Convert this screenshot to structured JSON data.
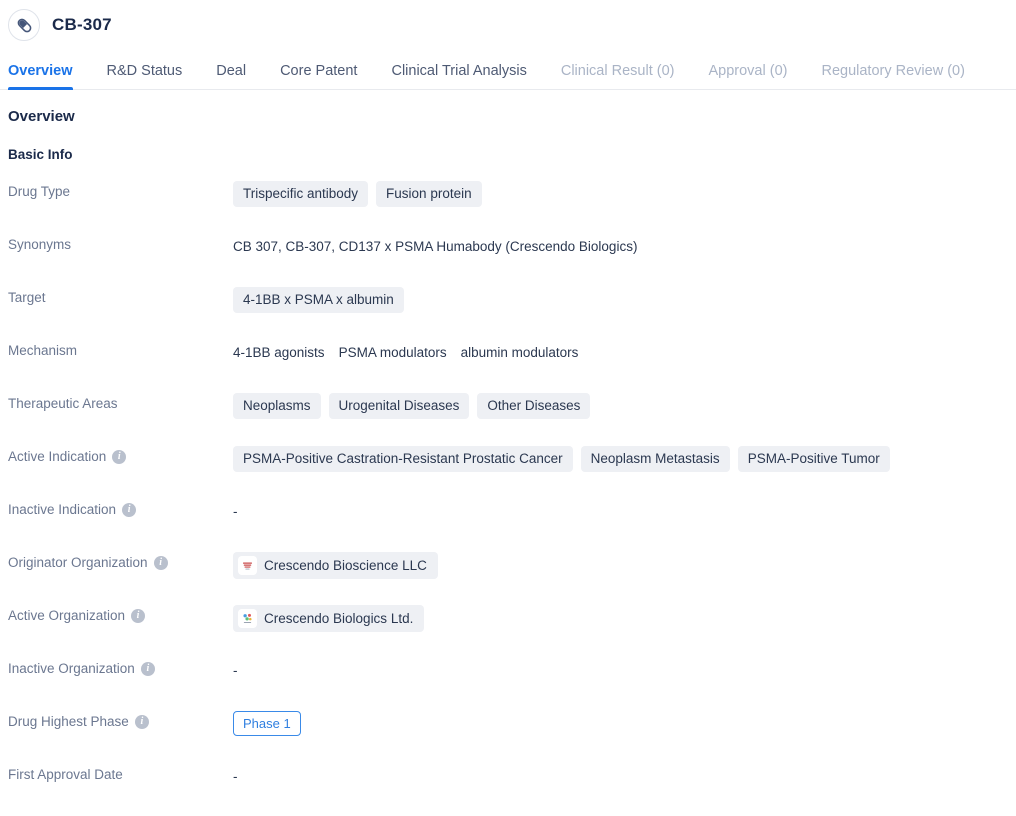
{
  "header": {
    "icon": "pill-icon",
    "title": "CB-307"
  },
  "tabs": [
    {
      "label": "Overview",
      "state": "active"
    },
    {
      "label": "R&D Status",
      "state": "enabled"
    },
    {
      "label": "Deal",
      "state": "enabled"
    },
    {
      "label": "Core Patent",
      "state": "enabled"
    },
    {
      "label": "Clinical Trial Analysis",
      "state": "enabled"
    },
    {
      "label": "Clinical Result (0)",
      "state": "disabled"
    },
    {
      "label": "Approval (0)",
      "state": "disabled"
    },
    {
      "label": "Regulatory Review (0)",
      "state": "disabled"
    }
  ],
  "overview": {
    "section_title": "Overview",
    "subsection_title": "Basic Info",
    "rows": {
      "drug_type": {
        "label": "Drug Type",
        "chips": [
          "Trispecific antibody",
          "Fusion protein"
        ]
      },
      "synonyms": {
        "label": "Synonyms",
        "text": "CB 307,  CB-307,  CD137 x PSMA Humabody (Crescendo Biologics)"
      },
      "target": {
        "label": "Target",
        "chips": [
          "4-1BB x PSMA x albumin"
        ]
      },
      "mechanism": {
        "label": "Mechanism",
        "values": [
          "4-1BB agonists",
          "PSMA modulators",
          "albumin modulators"
        ]
      },
      "therapeutic_areas": {
        "label": "Therapeutic Areas",
        "chips": [
          "Neoplasms",
          "Urogenital Diseases",
          "Other Diseases"
        ]
      },
      "active_indication": {
        "label": "Active Indication",
        "has_info": true,
        "chips": [
          "PSMA-Positive Castration-Resistant Prostatic Cancer",
          "Neoplasm Metastasis",
          "PSMA-Positive Tumor"
        ]
      },
      "inactive_indication": {
        "label": "Inactive Indication",
        "has_info": true,
        "value": "-"
      },
      "originator_organization": {
        "label": "Originator Organization",
        "has_info": true,
        "org": "Crescendo Bioscience LLC"
      },
      "active_organization": {
        "label": "Active Organization",
        "has_info": true,
        "org": "Crescendo Biologics Ltd."
      },
      "inactive_organization": {
        "label": "Inactive Organization",
        "has_info": true,
        "value": "-"
      },
      "drug_highest_phase": {
        "label": "Drug Highest Phase",
        "has_info": true,
        "badge": "Phase 1"
      },
      "first_approval_date": {
        "label": "First Approval Date",
        "value": "-"
      }
    }
  },
  "colors": {
    "accent": "#1a73e8",
    "label": "#6b7790",
    "value": "#2b3850",
    "chip_bg": "#eef0f4",
    "phase_border": "#3a8ae8"
  },
  "icons": {
    "info": "i"
  }
}
